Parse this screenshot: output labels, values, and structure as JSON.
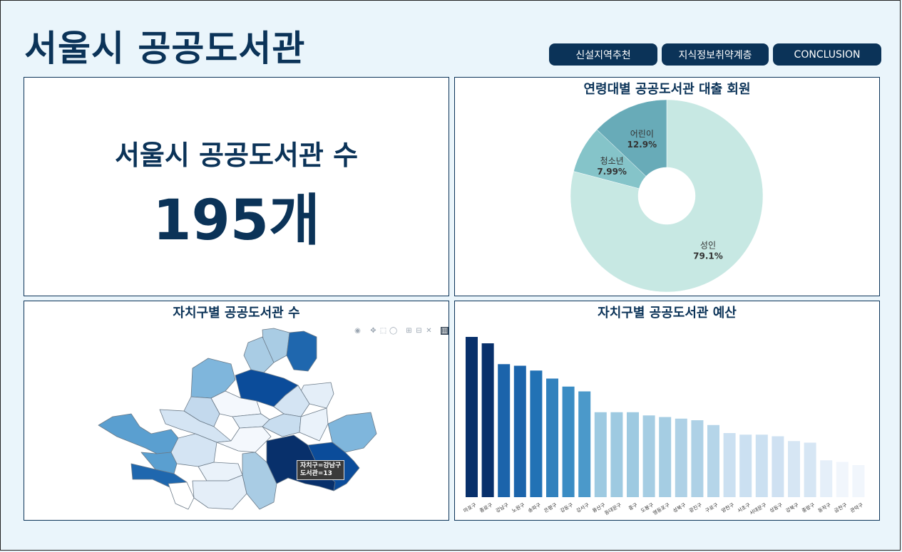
{
  "header": {
    "title": "서울시 공공도서관"
  },
  "nav": {
    "buttons": [
      "신설지역추천",
      "지식정보취약계층",
      "CONCLUSION"
    ]
  },
  "kpi": {
    "label": "서울시 공공도서관 수",
    "value": "195개"
  },
  "pie": {
    "title": "연령대별 공공도서관 대출 회원",
    "chart_data": {
      "type": "pie",
      "hole": true,
      "slices": [
        {
          "label": "성인",
          "value": 79.1,
          "text": "79.1%",
          "color": "#c7e8e3"
        },
        {
          "label": "청소년",
          "value": 7.99,
          "text": "7.99%",
          "color": "#85c4c9"
        },
        {
          "label": "어린이",
          "value": 12.9,
          "text": "12.9%",
          "color": "#68abb8"
        }
      ]
    }
  },
  "map": {
    "title": "자치구별 공공도서관 수",
    "tooltip": {
      "line1": "자치구=강남구",
      "line2": "도서관=13"
    },
    "modebar_icons": [
      "camera-icon",
      "pan-icon",
      "box-select-icon",
      "lasso-icon",
      "zoom-in-icon",
      "zoom-out-icon",
      "autoscale-icon",
      "plotly-logo-icon"
    ]
  },
  "bar": {
    "title": "자치구별 공공도서관 예산",
    "chart_data": {
      "type": "bar",
      "categories": [
        "마포구",
        "종로구",
        "강남구",
        "노원구",
        "송파구",
        "은평구",
        "강동구",
        "강서구",
        "용산구",
        "동대문구",
        "중구",
        "도봉구",
        "영등포구",
        "성북구",
        "광진구",
        "구로구",
        "양천구",
        "서초구",
        "서대문구",
        "성동구",
        "강북구",
        "중랑구",
        "동작구",
        "금천구",
        "관악구"
      ],
      "values": [
        100,
        96,
        83,
        82,
        79,
        74,
        69,
        66,
        53,
        53,
        53,
        51,
        50,
        49,
        48,
        45,
        40,
        39,
        39,
        38,
        35,
        34,
        23,
        22,
        20
      ],
      "colors": [
        "#08306b",
        "#08306b",
        "#1b64ab",
        "#1b64ab",
        "#2272b5",
        "#3181bd",
        "#3a8cc4",
        "#4b99ca",
        "#9ecae1",
        "#9ecae1",
        "#9ecae1",
        "#a5cde3",
        "#a5cde3",
        "#aed1e6",
        "#aed1e6",
        "#b5d5e9",
        "#cbe0f1",
        "#cbe0f1",
        "#cbe0f1",
        "#cfe1f2",
        "#d6e6f4",
        "#d6e6f4",
        "#e5eff9",
        "#f1f6fc",
        "#f1f6fc"
      ]
    }
  }
}
